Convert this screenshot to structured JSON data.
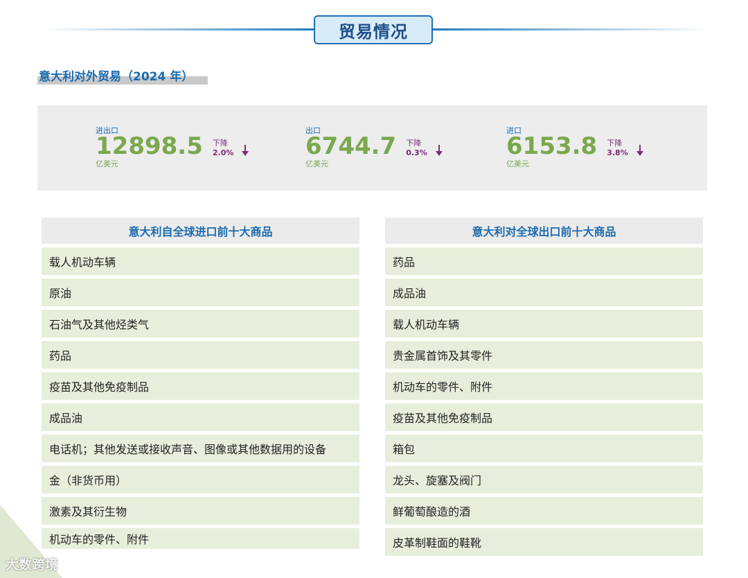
{
  "header": {
    "title": "贸易情况"
  },
  "subtitle": "意大利对外贸易（2024 年）",
  "stats": [
    {
      "label": "进出口",
      "value": "12898.5",
      "unit": "亿美元",
      "change_word": "下降",
      "change_pct": "2.0%"
    },
    {
      "label": "出口",
      "value": "6744.7",
      "unit": "亿美元",
      "change_word": "下降",
      "change_pct": "0.3%"
    },
    {
      "label": "进口",
      "value": "6153.8",
      "unit": "亿美元",
      "change_word": "下降",
      "change_pct": "3.8%"
    }
  ],
  "imports": {
    "heading": "意大利自全球进口前十大商品",
    "items": [
      "载人机动车辆",
      "原油",
      "石油气及其他烃类气",
      "药品",
      "疫苗及其他免疫制品",
      "成品油",
      "电话机；其他发送或接收声音、图像或其他数据用的设备",
      "金（非货币用）",
      "激素及其衍生物",
      "机动车的零件、附件"
    ]
  },
  "exports": {
    "heading": "意大利对全球出口前十大商品",
    "items": [
      "药品",
      "成品油",
      "载人机动车辆",
      "贵金属首饰及其零件",
      "机动车的零件、附件",
      "疫苗及其他免疫制品",
      "箱包",
      "龙头、旋塞及阀门",
      "鲜葡萄酿造的酒",
      "皮革制鞋面的鞋靴"
    ]
  },
  "watermark": "大数跨境",
  "colors": {
    "accent": "#1a6bb0",
    "value_green": "#7aa84e",
    "down_purple": "#7a2a7a",
    "row_bg": "#e7efdc"
  }
}
